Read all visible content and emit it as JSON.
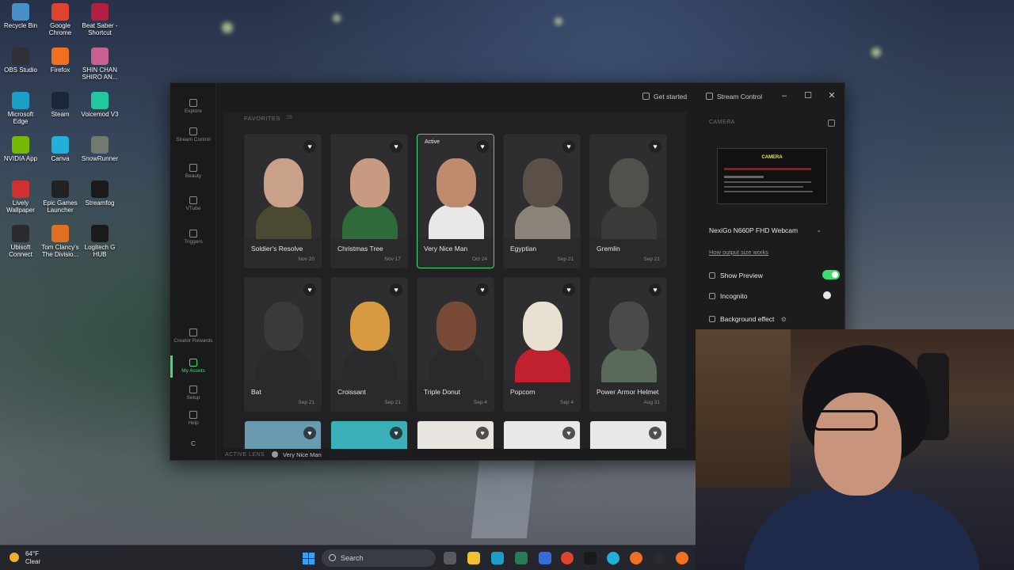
{
  "desktop": {
    "icons": [
      {
        "label": "Recycle Bin",
        "icon": "recycle-bin-icon",
        "color": "#4a90c8"
      },
      {
        "label": "Google Chrome",
        "icon": "chrome-icon",
        "color": "#e0442e"
      },
      {
        "label": "Beat Saber - Shortcut",
        "icon": "beat-saber-icon",
        "color": "#b02040"
      },
      {
        "label": "OBS Studio",
        "icon": "obs-icon",
        "color": "#303036"
      },
      {
        "label": "Firefox",
        "icon": "firefox-icon",
        "color": "#f07020"
      },
      {
        "label": "SHIN CHAN SHIRO AN...",
        "icon": "game-icon",
        "color": "#c86090"
      },
      {
        "label": "Microsoft Edge",
        "icon": "edge-icon",
        "color": "#1aa0c8"
      },
      {
        "label": "Steam",
        "icon": "steam-icon",
        "color": "#1b2838"
      },
      {
        "label": "Voicemod V3",
        "icon": "voicemod-icon",
        "color": "#20c8a0"
      },
      {
        "label": "NVIDIA App",
        "icon": "nvidia-icon",
        "color": "#76b900"
      },
      {
        "label": "Canva",
        "icon": "canva-icon",
        "color": "#20b0d8"
      },
      {
        "label": "SnowRunner",
        "icon": "snowrunner-icon",
        "color": "#707a70"
      },
      {
        "label": "Lively Wallpaper",
        "icon": "lively-icon",
        "color": "#d03030"
      },
      {
        "label": "Epic Games Launcher",
        "icon": "epic-icon",
        "color": "#222"
      },
      {
        "label": "Streamfog",
        "icon": "streamfog-icon",
        "color": "#1a1a1c"
      },
      {
        "label": "Ubisoft Connect",
        "icon": "ubisoft-icon",
        "color": "#2a2a30"
      },
      {
        "label": "Tom Clancy's The Divisio...",
        "icon": "division-icon",
        "color": "#e07020"
      },
      {
        "label": "Logitech G HUB",
        "icon": "logitech-icon",
        "color": "#1a1a1c"
      }
    ]
  },
  "rail": {
    "items": [
      {
        "label": "Explore",
        "icon": "explore-icon"
      },
      {
        "label": "Stream Control",
        "icon": "stream-control-icon"
      },
      {
        "label": "Beauty",
        "icon": "beauty-icon"
      },
      {
        "label": "VTube",
        "icon": "vtube-icon"
      },
      {
        "label": "Triggers",
        "icon": "triggers-icon"
      }
    ],
    "bottom": [
      {
        "label": "Creator Rewards",
        "icon": "creator-rewards-icon"
      },
      {
        "label": "My Assets",
        "icon": "my-assets-icon",
        "active": true
      },
      {
        "label": "Setup",
        "icon": "setup-icon"
      },
      {
        "label": "Help",
        "icon": "help-icon"
      }
    ],
    "avatar": "C"
  },
  "titlebar": {
    "get_started": "Get started",
    "stream_control": "Stream Control",
    "minimize": "–",
    "maximize": "☐",
    "close": "✕"
  },
  "favorites": {
    "heading": "FAVORITES",
    "count": "18"
  },
  "lenses": [
    {
      "name": "Soldier's Resolve",
      "date": "Nov 20",
      "active": false
    },
    {
      "name": "Christmas Tree",
      "date": "Nov 17",
      "active": false
    },
    {
      "name": "Very Nice Man",
      "date": "Oct 24",
      "active": true,
      "badge": "Active"
    },
    {
      "name": "Egyptian",
      "date": "Sep 21",
      "active": false
    },
    {
      "name": "Gremlin",
      "date": "Sep 21",
      "active": false
    },
    {
      "name": "Bat",
      "date": "Sep 21",
      "active": false
    },
    {
      "name": "Croissant",
      "date": "Sep 21",
      "active": false
    },
    {
      "name": "Triple Donut",
      "date": "Sep 4",
      "active": false
    },
    {
      "name": "Popcorn",
      "date": "Sep 4",
      "active": false
    },
    {
      "name": "Power Armor Helmet",
      "date": "Aug 31",
      "active": false
    }
  ],
  "active_lens": {
    "label": "ACTIVE LENS",
    "value": "Very Nice Man"
  },
  "camera": {
    "heading": "CAMERA",
    "preview_title": "CAMERA",
    "device": "NexiGo N660P FHD Webcam",
    "how_link": "How output size works",
    "show_preview": "Show Preview",
    "show_preview_on": true,
    "incognito": "Incognito",
    "incognito_on": false,
    "background_effect": "Background effect"
  },
  "taskbar": {
    "temp": "64°F",
    "condition": "Clear",
    "search": "Search"
  },
  "colors": {
    "accent": "#3ddc6e"
  }
}
